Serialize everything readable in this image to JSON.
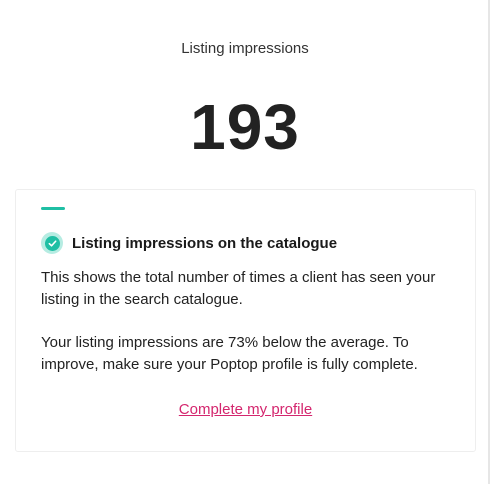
{
  "metric": {
    "label": "Listing impressions",
    "value": "193"
  },
  "info_card": {
    "icon": "check-circle-icon",
    "title": "Listing impressions on the catalogue",
    "description": "This shows the total number of times a client has seen your listing in the search catalogue.",
    "insight": "Your listing impressions are 73% below the average. To improve, make sure your Poptop profile is fully complete.",
    "cta_label": "Complete my profile"
  },
  "colors": {
    "accent": "#1fbfa4",
    "link": "#d4266e"
  }
}
